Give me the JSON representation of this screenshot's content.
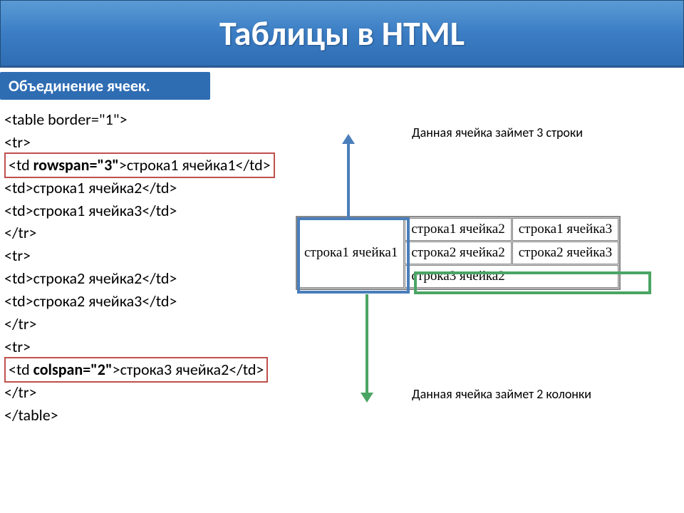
{
  "title": "Таблицы в HTML",
  "subtitle": "Объединение ячеек.",
  "code": {
    "l1": "<table border=\"1\">",
    "l2": "<tr>",
    "l3_a": "<td ",
    "l3_b": "rowspan=\"3\"",
    "l3_c": ">строка1 ячейка1</td>",
    "l4": "<td>строка1 ячейка2</td>",
    "l5": "<td>строка1 ячейка3</td>",
    "l6": "</tr>",
    "l7": "<tr>",
    "l8": "<td>строка2 ячейка2</td>",
    "l9": "<td>строка2 ячейка3</td>",
    "l10": "</tr>",
    "l11": "<tr>",
    "l12_a": "<td ",
    "l12_b": "colspan=\"2\"",
    "l12_c": ">строка3 ячейка2</td>",
    "l13": "</tr>",
    "l14": "</table>"
  },
  "annotations": {
    "top": "Данная ячейка займет 3 строки",
    "bottom": "Данная ячейка займет 2 колонки"
  },
  "demo": {
    "c11": "строка1 ячейка1",
    "c12": "строка1 ячейка2",
    "c13": "строка1 ячейка3",
    "c22": "строка2 ячейка2",
    "c23": "строка2 ячейка3",
    "c32": "строка3 ячейка2"
  }
}
